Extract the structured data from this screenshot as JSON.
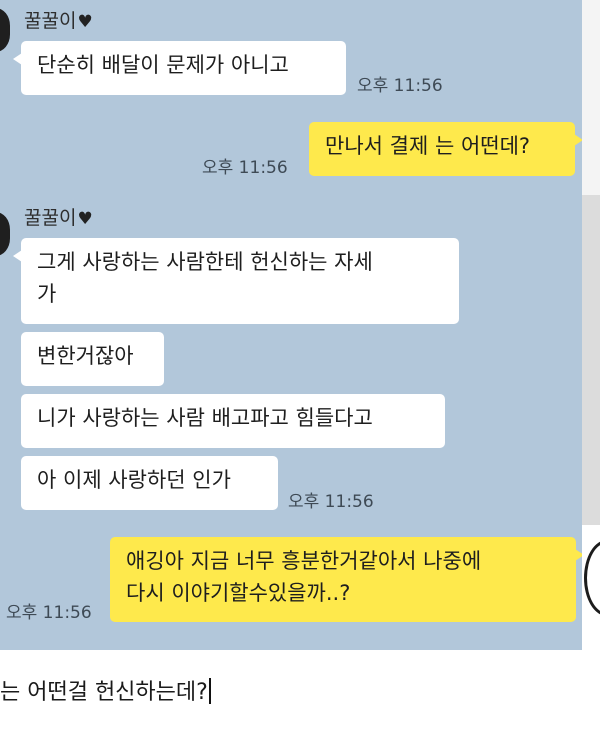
{
  "chat": {
    "messages": [
      {
        "sender_name": "꿀꿀이",
        "heart_icon": "heart-icon",
        "text": "단순히 배달이 문제가 아니고",
        "time": "오후 11:56"
      },
      {
        "from_me": true,
        "text": "만나서 결제 는 어떤데?",
        "time": "오후 11:56"
      },
      {
        "sender_name": "꿀꿀이",
        "heart_icon": "heart-icon"
      },
      {
        "text_line1": "그게 사랑하는 사람한테 헌신하는 자세",
        "text_line2": "가"
      },
      {
        "text": "변한거잖아"
      },
      {
        "text": "니가 사랑하는 사람 배고파고 힘들다고"
      },
      {
        "text": "아 이제 사랑하던 인가",
        "time": "오후 11:56"
      },
      {
        "from_me": true,
        "text_line1": "애깅아 지금 너무 흥분한거같아서 나중에",
        "text_line2": "다시 이야기할수있을까..?",
        "time": "오후 11:56"
      }
    ]
  },
  "composer": {
    "text": "는 어떤걸 헌신하는데?"
  },
  "colors": {
    "chat_background": "#b2c7da",
    "my_bubble": "#fee94c",
    "their_bubble": "#ffffff"
  }
}
